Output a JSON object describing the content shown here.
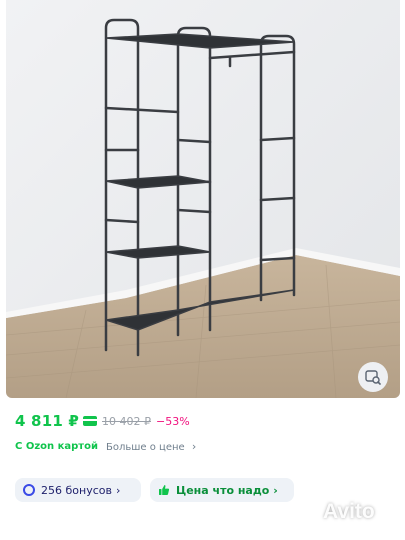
{
  "product": {
    "image_alt": "Metal clothes rack with shelves",
    "price": "4 811 ₽",
    "old_price": "10 402 ₽",
    "discount": "−53%",
    "card_label": "С Ozon картой",
    "more_price_label": "Больше о цене",
    "more_price_chevron": "›"
  },
  "chips": {
    "bonus_label": "256 бонусов",
    "bonus_chevron": "›",
    "good_price_label": "Цена что надо",
    "good_price_chevron": "›"
  },
  "watermark": {
    "text": "Avito"
  },
  "colors": {
    "accent_green": "#10c44c",
    "discount_pink": "#f1117e",
    "chip_bg": "#eef2f7"
  },
  "icons": {
    "search_photo": "image-search-icon",
    "card": "card-icon",
    "bonus": "bonus-icon",
    "good_price": "thumbs-up-icon"
  }
}
